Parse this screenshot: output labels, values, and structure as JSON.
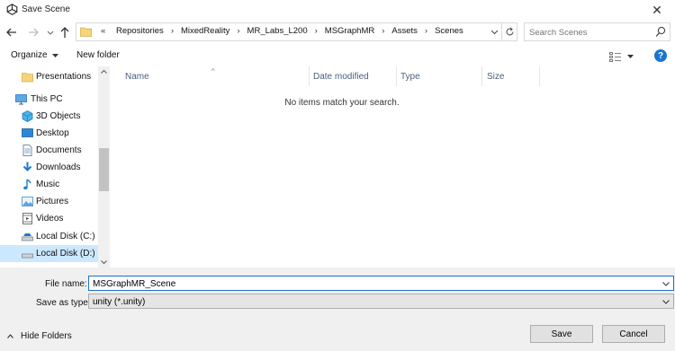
{
  "window": {
    "title": "Save Scene"
  },
  "nav": {
    "breadcrumbs": [
      "Repositories",
      "MixedReality",
      "MR_Labs_L200",
      "MSGraphMR",
      "Assets",
      "Scenes"
    ],
    "overflow": "«"
  },
  "search": {
    "placeholder": "Search Scenes"
  },
  "toolbar": {
    "organize_label": "Organize",
    "new_folder_label": "New folder",
    "help_label": "?"
  },
  "navpane": {
    "items": [
      {
        "label": "Presentations",
        "icon": "folder-icon"
      },
      {
        "label": "This PC",
        "icon": "computer-icon"
      },
      {
        "label": "3D Objects",
        "icon": "cube-icon"
      },
      {
        "label": "Desktop",
        "icon": "desktop-icon"
      },
      {
        "label": "Documents",
        "icon": "document-icon"
      },
      {
        "label": "Downloads",
        "icon": "download-icon"
      },
      {
        "label": "Music",
        "icon": "music-icon"
      },
      {
        "label": "Pictures",
        "icon": "picture-icon"
      },
      {
        "label": "Videos",
        "icon": "video-icon"
      },
      {
        "label": "Local Disk (C:)",
        "icon": "drive-icon"
      },
      {
        "label": "Local Disk (D:)",
        "icon": "drive-icon",
        "selected": true
      }
    ]
  },
  "filelist": {
    "columns": [
      "Name",
      "Date modified",
      "Type",
      "Size"
    ],
    "empty_message": "No items match your search."
  },
  "form": {
    "file_name_label": "File name:",
    "file_name_value": "MSGraphMR_Scene",
    "save_as_type_label": "Save as type:",
    "save_as_type_value": "unity (*.unity)"
  },
  "footer": {
    "hide_folders_label": "Hide Folders",
    "save_label": "Save",
    "cancel_label": "Cancel"
  },
  "colors": {
    "accent": "#1a74d4",
    "selection": "#cce8ff",
    "bottom_bg": "#f0f0f0"
  }
}
